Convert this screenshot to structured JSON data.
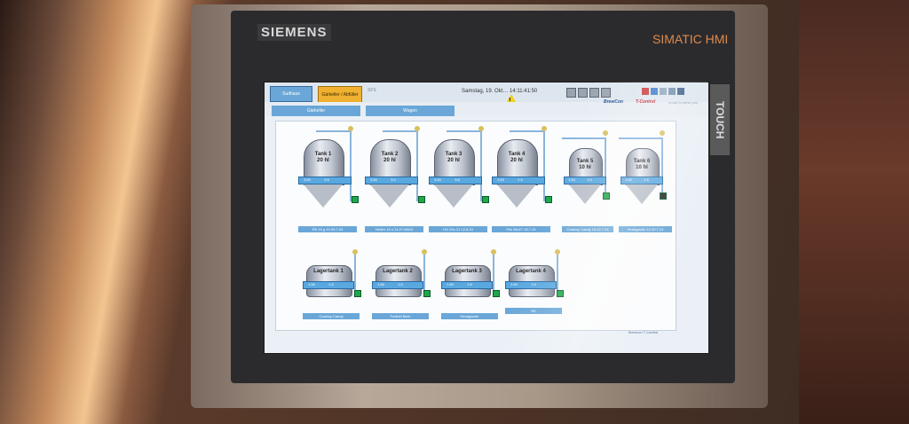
{
  "device": {
    "brand": "SIEMENS",
    "model": "SIMATIC HMI",
    "side_label": "TOUCH"
  },
  "topbar": {
    "sudhaus_label": "Sudhaus",
    "gaerkeller_label": "Gärkeller / Abfüller",
    "sfs_label": "SFS",
    "datetime": "Samstag, 19. Okt…  14:11:41:50",
    "alarm_count": "1"
  },
  "tabs": {
    "gaerkeller": "Gärkeller",
    "wagen": "Wagen"
  },
  "branding": {
    "brewcon": "BrewCon",
    "tcontrol": "T-Control",
    "tagline": "proud to serve you"
  },
  "tanks": [
    {
      "name": "Tank 1",
      "vol": "20 hl",
      "val": "3.50",
      "val2": "3.5",
      "label": "RE 15 g 19.29.7.24"
    },
    {
      "name": "Tank 2",
      "vol": "20 hl",
      "val": "3.50",
      "val2": "3.0",
      "label": "Hellen 13 u 14.27.8/624"
    },
    {
      "name": "Tank 3",
      "vol": "20 hl",
      "val": "3.50",
      "val2": "3.6",
      "label": "HG 20u 21 12.8.24"
    },
    {
      "name": "Tank 4",
      "vol": "20 hl",
      "val": "1.50",
      "val2": "1.5",
      "label": "Pils 26u27 15.7.24"
    },
    {
      "name": "Tank 5",
      "vol": "10 hl",
      "val": "1.50",
      "val2": "1.5",
      "label": "Cowboy Candy 16.02.7.24"
    },
    {
      "name": "Tank 6",
      "vol": "10 hl",
      "val": "1.50",
      "val2": "1.5",
      "label": "Heubgauler 12.20.7.24"
    }
  ],
  "lagertanks": [
    {
      "name": "Lagertank 1",
      "val": "1.50",
      "val2": "1.5",
      "label": "Cowboy Candy"
    },
    {
      "name": "Lagertank 2",
      "val": "1.50",
      "val2": "1.5",
      "label": "Festbel Beer"
    },
    {
      "name": "Lagertank 3",
      "val": "1.50",
      "val2": "1.5",
      "label": "Heudgauter"
    },
    {
      "name": "Lagertank 4",
      "val": "1.50",
      "val2": "1.5",
      "label": "RE"
    }
  ],
  "status_text": "Brewcon T-Control",
  "colors": {
    "accent": "#6aa7d8",
    "alert": "#f0b030",
    "ok": "#1ea84a"
  }
}
